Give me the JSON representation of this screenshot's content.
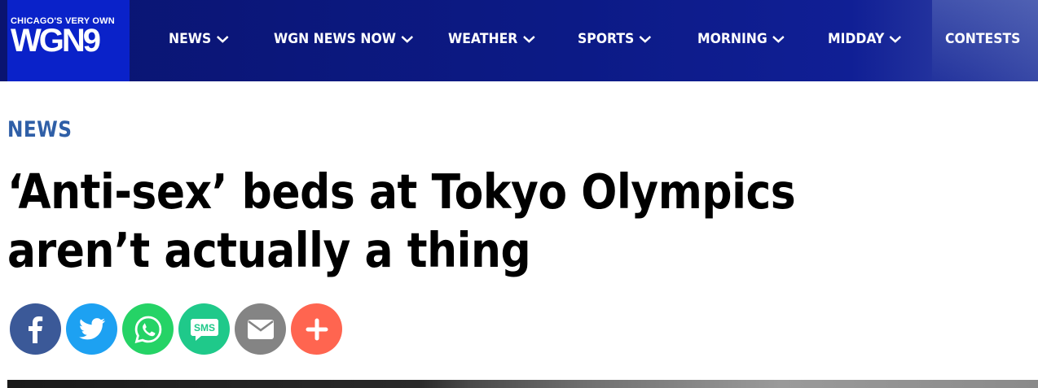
{
  "logo": {
    "tagline": "CHICAGO'S VERY OWN",
    "mark": "WGN9"
  },
  "nav": [
    {
      "label": "NEWS",
      "has_dropdown": true
    },
    {
      "label": "WGN NEWS NOW",
      "has_dropdown": true
    },
    {
      "label": "WEATHER",
      "has_dropdown": true
    },
    {
      "label": "SPORTS",
      "has_dropdown": true
    },
    {
      "label": "MORNING",
      "has_dropdown": true
    },
    {
      "label": "MIDDAY",
      "has_dropdown": true
    },
    {
      "label": "CONTESTS",
      "has_dropdown": false
    }
  ],
  "article": {
    "section": "NEWS",
    "headline": "‘Anti-sex’ beds at Tokyo Olympics aren’t actually a thing"
  },
  "share": [
    {
      "icon": "facebook-icon",
      "color": "#3b5998"
    },
    {
      "icon": "twitter-icon",
      "color": "#1da1f2"
    },
    {
      "icon": "whatsapp-icon",
      "color": "#25d366"
    },
    {
      "icon": "sms-icon",
      "label": "SMS",
      "color": "#1fc98a"
    },
    {
      "icon": "email-icon",
      "color": "#848484"
    },
    {
      "icon": "plus-icon",
      "color": "#ff6550"
    }
  ],
  "colors": {
    "nav_bg": "#0c1a86",
    "logo_bg": "#0a22c9",
    "section_label": "#2f5fa7"
  }
}
